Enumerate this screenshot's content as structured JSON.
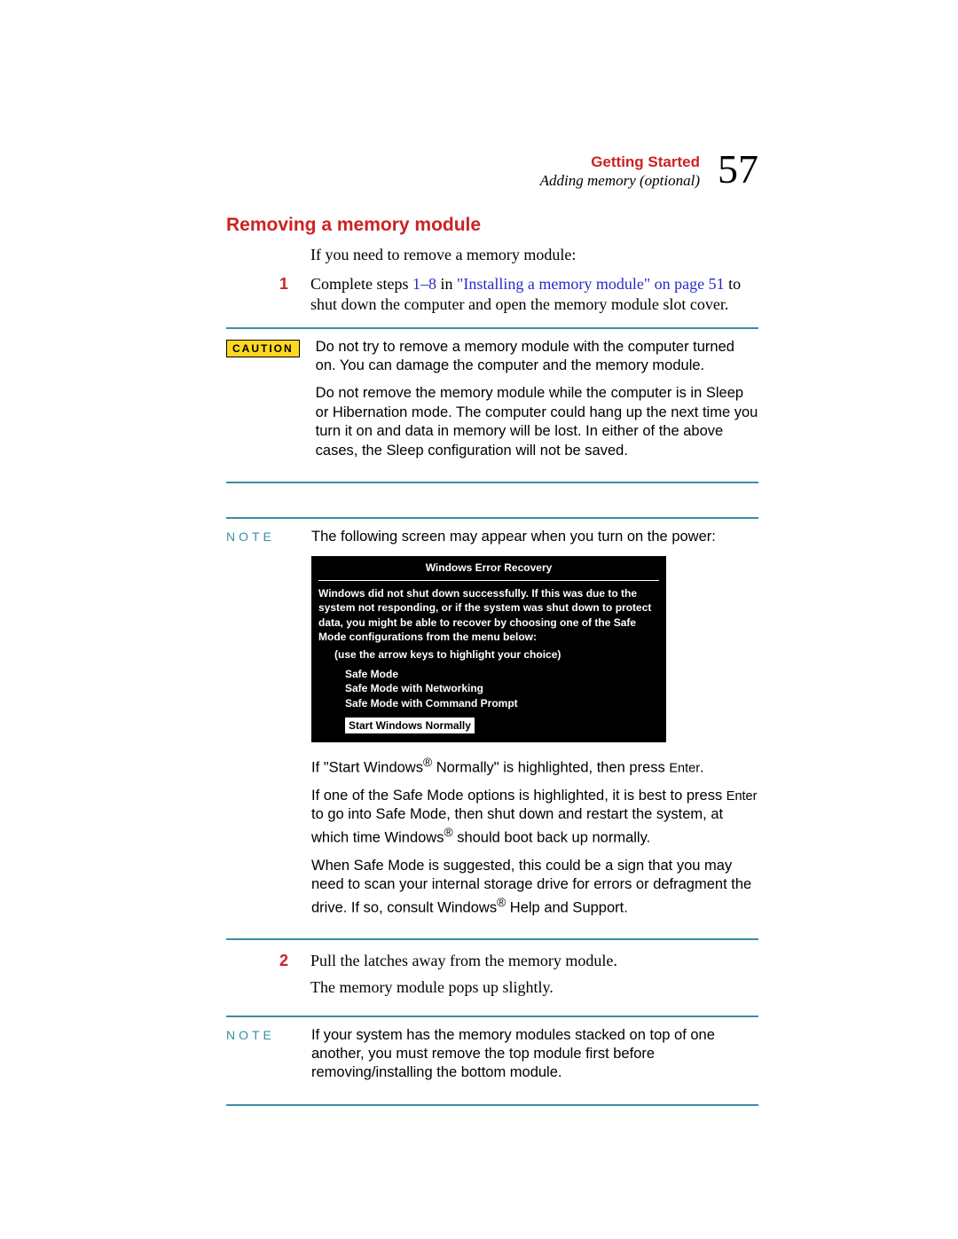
{
  "header": {
    "chapter": "Getting Started",
    "section": "Adding memory (optional)",
    "page_number": "57"
  },
  "heading": "Removing a memory module",
  "intro": "If you need to remove a memory module:",
  "step1": {
    "num": "1",
    "prefix": "Complete steps ",
    "link_range": "1–8",
    "link_mid": " in ",
    "link_text": "\"Installing a memory module\" on page 51",
    "suffix": " to shut down the computer and open the memory module slot cover."
  },
  "caution": {
    "label": "CAUTION",
    "p1": "Do not try to remove a memory module with the computer turned on. You can damage the computer and the memory module.",
    "p2": "Do not remove the memory module while the computer is in Sleep or Hibernation mode. The computer could hang up the next time you turn it on and data in memory will be lost. In either of the above cases, the Sleep configuration will not be saved."
  },
  "note1": {
    "label": "NOTE",
    "intro": "The following screen may appear when you turn on the power:",
    "boot": {
      "title": "Windows Error Recovery",
      "msg": "Windows did not shut down successfully. If this was due to the system not responding, or if the system was shut down to protect data, you might be able to recover by choosing one of the Safe Mode configurations from the menu below:",
      "hint": "(use the arrow keys to highlight your choice)",
      "opt1": "Safe Mode",
      "opt2": "Safe Mode with Networking",
      "opt3": "Safe Mode with Command Prompt",
      "start": "Start Windows Normally"
    },
    "p_start_a": "If \"Start Windows",
    "p_start_b": " Normally\" is highlighted, then press ",
    "enter_key": "Enter",
    "p_start_c": ".",
    "p_safe_a": "If one of the Safe Mode options is highlighted, it is best to press ",
    "p_safe_b": " to go into Safe Mode, then shut down and restart the system, at which time Windows",
    "p_safe_c": " should boot back up normally.",
    "p_scan_a": "When Safe Mode is suggested, this could be a sign that you may need to scan your internal storage drive for errors or defragment the drive. If so, consult Windows",
    "p_scan_b": " Help and Support."
  },
  "step2": {
    "num": "2",
    "line1": "Pull the latches away from the memory module.",
    "line2": "The memory module pops up slightly."
  },
  "note2": {
    "label": "NOTE",
    "text": "If your system has the memory modules stacked on top of one another, you must remove the top module first before removing/installing the bottom module."
  },
  "reg_mark": "®"
}
